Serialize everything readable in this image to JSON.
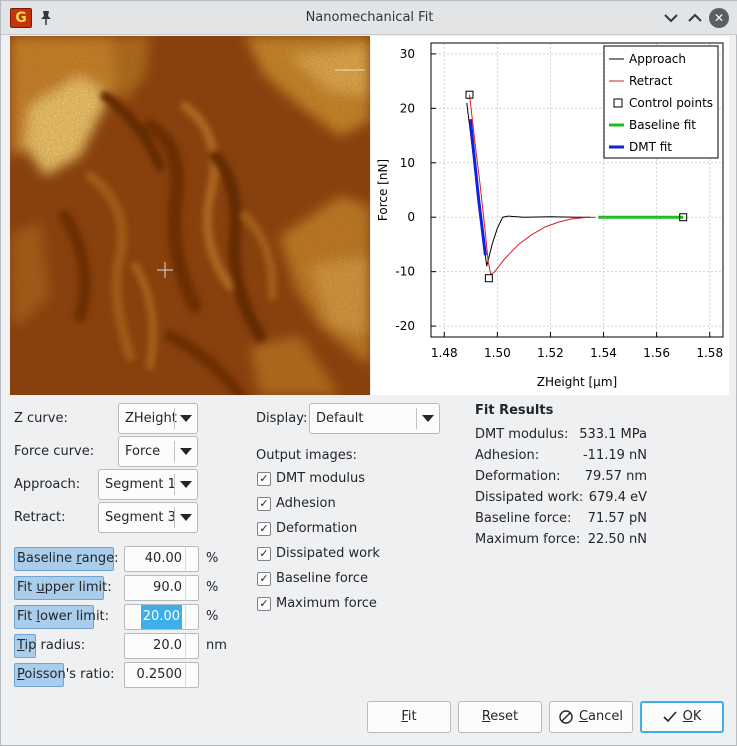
{
  "window": {
    "title": "Nanomechanical Fit"
  },
  "icons": {
    "app": "gwyddion-app-icon",
    "pin": "pin-icon",
    "minimize": "chevron-down-icon",
    "maximize": "chevron-up-icon",
    "close": "close-icon",
    "cancel": "cancel-icon",
    "ok": "checkmark-icon"
  },
  "chart_data": {
    "type": "line",
    "xlabel": "ZHeight [μm]",
    "ylabel": "Force [nN]",
    "xlim": [
      1.475,
      1.585
    ],
    "ylim": [
      -22,
      32
    ],
    "xticks": [
      "1.48",
      "1.50",
      "1.52",
      "1.54",
      "1.56",
      "1.58"
    ],
    "xtick_values": [
      1.48,
      1.5,
      1.52,
      1.54,
      1.56,
      1.58
    ],
    "yticks": [
      "30",
      "20",
      "10",
      "0",
      "-10",
      "-20"
    ],
    "ytick_values": [
      30,
      20,
      10,
      0,
      -10,
      -20
    ],
    "grid": true,
    "legend_position": "top-right",
    "legend": [
      "Approach",
      "Retract",
      "Control points",
      "Baseline fit",
      "DMT fit"
    ],
    "series": [
      {
        "name": "Approach",
        "color": "#000000",
        "x": [
          1.4885,
          1.4905,
          1.4925,
          1.4945,
          1.496,
          1.498,
          1.5,
          1.502,
          1.504,
          1.51,
          1.52,
          1.53,
          1.535
        ],
        "y": [
          21,
          13,
          5,
          -3,
          -9,
          -5,
          -2,
          0,
          0.2,
          0,
          0.1,
          0,
          0
        ]
      },
      {
        "name": "Retract",
        "color": "#d62020",
        "x": [
          1.4895,
          1.4915,
          1.4935,
          1.4955,
          1.4965,
          1.4975,
          1.499,
          1.503,
          1.508,
          1.513,
          1.518,
          1.523,
          1.528,
          1.533,
          1.537
        ],
        "y": [
          22.5,
          14,
          6,
          -3,
          -8,
          -10.5,
          -10,
          -7.5,
          -5,
          -3.2,
          -1.8,
          -0.9,
          -0.3,
          -0.05,
          0
        ]
      },
      {
        "name": "Control points",
        "marker": "square",
        "x": [
          1.4895,
          1.4968,
          1.57
        ],
        "y": [
          22.5,
          -11.2,
          0
        ]
      },
      {
        "name": "Baseline fit",
        "color": "#22bb22",
        "x": [
          1.538,
          1.57
        ],
        "y": [
          0,
          0
        ]
      },
      {
        "name": "DMT fit",
        "color": "#1022dd",
        "x": [
          1.4898,
          1.4915,
          1.493,
          1.4945,
          1.4955
        ],
        "y": [
          18,
          10,
          3,
          -3,
          -7
        ]
      }
    ]
  },
  "form": {
    "z_curve": {
      "label": "Z curve:",
      "value": "ZHeight"
    },
    "force_curve": {
      "label": "Force curve:",
      "value": "Force"
    },
    "approach": {
      "label": "Approach:",
      "value": "Segment 1"
    },
    "retract": {
      "label": "Retract:",
      "value": "Segment 3"
    },
    "display": {
      "label": "Display:",
      "value": "Default"
    }
  },
  "params": [
    {
      "pre": "Baseline ",
      "ul": "r",
      "post": "ange:",
      "value": "40.00",
      "unit": "%",
      "fill": 1.0,
      "selected": false
    },
    {
      "pre": "Fit ",
      "ul": "u",
      "post": "pper limit:",
      "value": "90.0",
      "unit": "%",
      "fill": 0.9,
      "selected": false
    },
    {
      "pre": "Fit ",
      "ul": "l",
      "post": "ower limit:",
      "value": "20.00",
      "unit": "%",
      "fill": 0.8,
      "selected": true
    },
    {
      "pre": "",
      "ul": "T",
      "post": "ip radius:",
      "value": "20.0",
      "unit": "nm",
      "fill": 0.22,
      "selected": false
    },
    {
      "pre": "",
      "ul": "P",
      "post": "oisson's ratio:",
      "value": "0.2500",
      "unit": "",
      "fill": 0.5,
      "selected": false
    }
  ],
  "output_images": {
    "label": "Output images:",
    "items": [
      {
        "label": "DMT modulus",
        "checked": true
      },
      {
        "label": "Adhesion",
        "checked": true
      },
      {
        "label": "Deformation",
        "checked": true
      },
      {
        "label": "Dissipated work",
        "checked": true
      },
      {
        "label": "Baseline force",
        "checked": true
      },
      {
        "label": "Maximum force",
        "checked": true
      }
    ]
  },
  "results": {
    "title": "Fit Results",
    "rows": [
      {
        "label": "DMT modulus:",
        "value": "533.1 MPa"
      },
      {
        "label": "Adhesion:",
        "value": "-11.19 nN"
      },
      {
        "label": "Deformation:",
        "value": "79.57 nm"
      },
      {
        "label": "Dissipated work:",
        "value": "679.4 eV"
      },
      {
        "label": "Baseline force:",
        "value": "71.57 pN"
      },
      {
        "label": "Maximum force:",
        "value": "22.50 nN"
      }
    ]
  },
  "buttons": {
    "fit": {
      "ul": "F",
      "rest": "it"
    },
    "reset": {
      "ul": "R",
      "rest": "eset"
    },
    "cancel": {
      "ul": "C",
      "rest": "ancel"
    },
    "ok": {
      "ul": "O",
      "rest": "K"
    }
  },
  "colors": {
    "accent": "#3daee9",
    "selection_bar": "#a9cdeb"
  }
}
